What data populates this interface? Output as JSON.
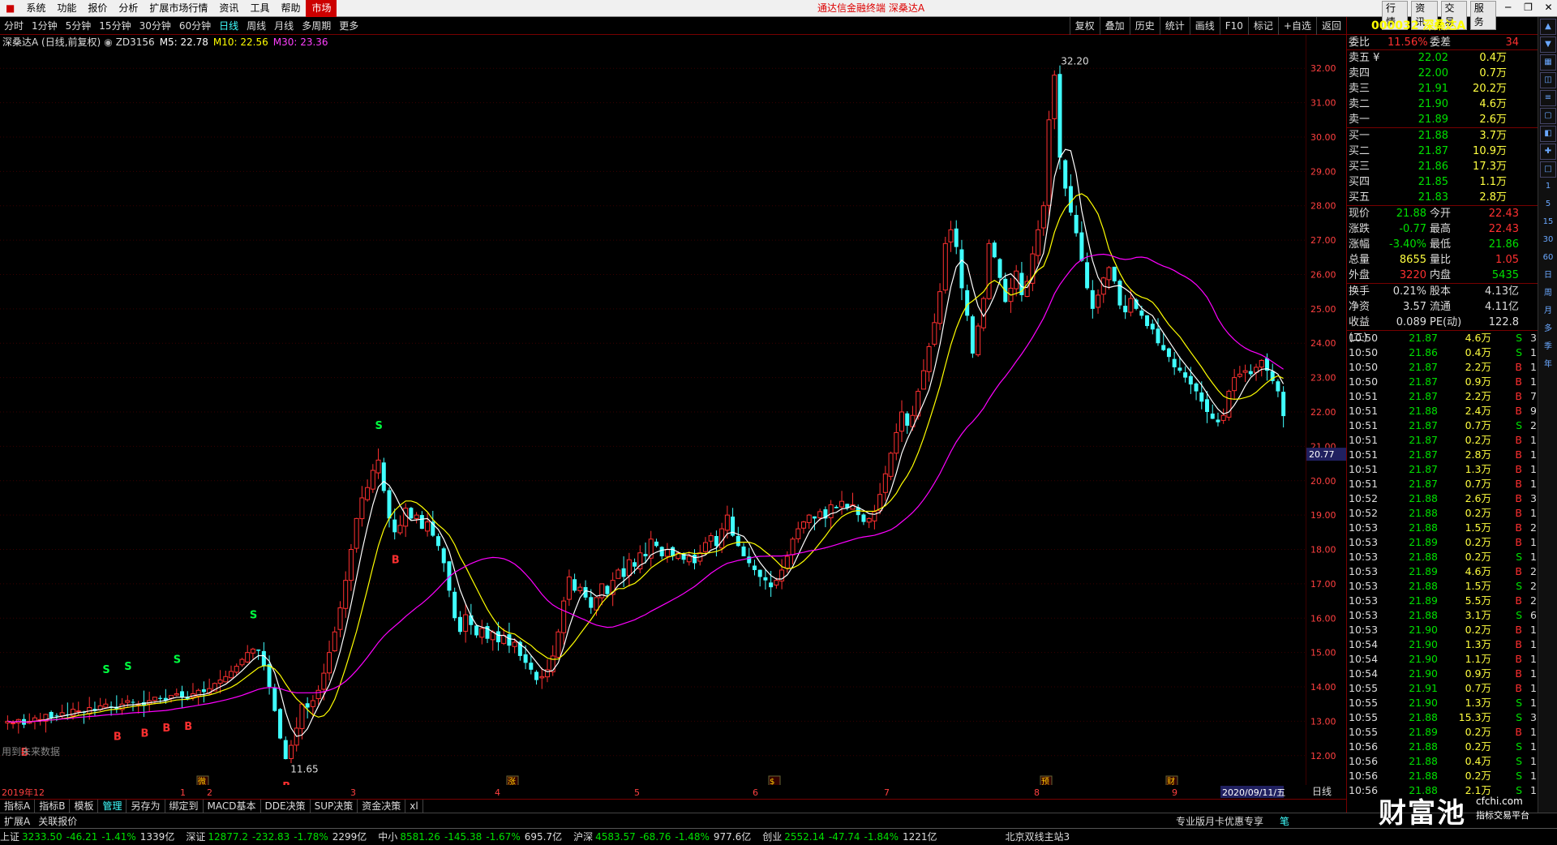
{
  "menu": {
    "items": [
      "系统",
      "功能",
      "报价",
      "分析",
      "扩展市场行情",
      "资讯",
      "工具",
      "帮助",
      "市场"
    ],
    "title": "通达信金融终端  深桑达A",
    "right_tabs": [
      "行情",
      "资讯",
      "交易",
      "服务"
    ]
  },
  "periods": [
    "分时",
    "1分钟",
    "5分钟",
    "15分钟",
    "30分钟",
    "60分钟",
    "日线",
    "周线",
    "月线",
    "多周期",
    "更多"
  ],
  "selected_period": "日线",
  "tools": [
    "复权",
    "叠加",
    "历史",
    "统计",
    "画线",
    "F10",
    "标记",
    "+自选",
    "返回"
  ],
  "info": {
    "name": "深桑达A (日线,前复权)",
    "zd": "ZD3156",
    "m5": "M5: 22.78",
    "m10": "M10: 22.56",
    "m30": "M30: 23.36"
  },
  "colors": {
    "up": "#ff3030",
    "down": "#40ffff",
    "ma5": "#ffffff",
    "ma10": "#ffff00",
    "ma30": "#ff00ff"
  },
  "chart_data": {
    "type": "candlestick",
    "ylim": [
      11.5,
      32.5
    ],
    "y_ticks": [
      "12.00",
      "13.00",
      "14.00",
      "15.00",
      "16.00",
      "17.00",
      "18.00",
      "19.00",
      "20.00",
      "21.00",
      "22.00",
      "23.00",
      "24.00",
      "25.00",
      "26.00",
      "27.00",
      "28.00",
      "29.00",
      "30.00",
      "31.00",
      "32.00"
    ],
    "cursor_price": "20.77",
    "high_label": "32.20",
    "low_label": "11.65",
    "x_labels": [
      "2019年12",
      "1",
      "2",
      "3",
      "4",
      "5",
      "6",
      "7",
      "8",
      "9"
    ],
    "date_label": "2020/09/11/五",
    "period_label": "日线",
    "future_note": "用到未来数据",
    "events": [
      "微",
      "涨",
      "$",
      "预",
      "财"
    ],
    "signals": [
      "S",
      "B",
      "S",
      "B",
      "B",
      "S",
      "B",
      "S",
      "B",
      "S",
      "S",
      "B"
    ],
    "closes": [
      13.0,
      12.95,
      13.05,
      12.9,
      13.0,
      13.1,
      13.05,
      13.2,
      13.1,
      13.15,
      13.25,
      13.2,
      13.35,
      13.3,
      13.25,
      13.4,
      13.3,
      13.45,
      13.5,
      13.4,
      13.35,
      13.5,
      13.6,
      13.55,
      13.5,
      13.45,
      13.6,
      13.7,
      13.65,
      13.6,
      13.75,
      13.8,
      13.7,
      13.65,
      13.8,
      13.9,
      13.85,
      13.95,
      14.1,
      14.2,
      14.3,
      14.45,
      14.6,
      14.8,
      15.0,
      15.1,
      15.05,
      14.6,
      14.0,
      13.3,
      12.5,
      11.9,
      12.3,
      12.8,
      13.5,
      13.4,
      13.6,
      13.9,
      14.4,
      15.0,
      15.6,
      16.3,
      17.1,
      18.0,
      18.9,
      19.5,
      19.8,
      20.3,
      20.6,
      19.7,
      18.9,
      18.5,
      18.7,
      19.2,
      18.9,
      19.0,
      18.6,
      18.8,
      18.4,
      18.1,
      17.6,
      16.8,
      16.0,
      15.6,
      16.1,
      15.8,
      15.5,
      15.7,
      15.4,
      15.6,
      15.3,
      15.5,
      15.2,
      15.3,
      14.9,
      14.7,
      14.5,
      14.2,
      14.3,
      14.5,
      14.9,
      15.6,
      16.5,
      17.2,
      16.8,
      16.9,
      16.6,
      16.3,
      16.6,
      17.0,
      16.7,
      17.1,
      17.4,
      17.2,
      17.7,
      17.5,
      17.9,
      17.8,
      18.3,
      18.1,
      17.8,
      18.0,
      17.8,
      17.9,
      17.7,
      17.8,
      17.6,
      17.9,
      18.2,
      18.4,
      18.1,
      18.6,
      19.0,
      18.4,
      18.1,
      17.8,
      17.6,
      17.4,
      17.2,
      17.1,
      16.9,
      17.1,
      17.4,
      17.8,
      18.3,
      18.6,
      18.8,
      19.0,
      18.9,
      19.1,
      18.9,
      19.3,
      19.2,
      19.4,
      19.2,
      19.3,
      19.0,
      18.8,
      18.9,
      19.1,
      19.6,
      20.2,
      20.8,
      21.4,
      22.0,
      21.6,
      21.9,
      22.6,
      23.2,
      23.9,
      24.6,
      25.5,
      26.9,
      27.3,
      26.8,
      25.6,
      24.8,
      23.7,
      24.5,
      25.3,
      26.9,
      26.5,
      25.9,
      25.2,
      25.6,
      26.1,
      25.4,
      25.8,
      26.6,
      27.3,
      28.0,
      30.5,
      31.8,
      29.4,
      28.5,
      27.8,
      27.2,
      26.4,
      25.6,
      25.0,
      25.4,
      25.9,
      26.2,
      25.8,
      25.1,
      24.9,
      25.3,
      25.0,
      24.8,
      24.5,
      24.4,
      24.0,
      23.8,
      23.6,
      23.3,
      23.2,
      23.0,
      22.8,
      22.6,
      22.3,
      22.0,
      21.8,
      21.7,
      21.9,
      22.6,
      23.0,
      23.1,
      23.2,
      23.1,
      23.3,
      23.5,
      23.2,
      22.9,
      22.6,
      21.88
    ]
  },
  "quote": {
    "code": "000032 深桑达A",
    "weibi_label": "委比",
    "weibi": "11.56%",
    "weicha_label": "委差",
    "weicha": "34",
    "sell": [
      {
        "label": "卖五 ¥",
        "price": "22.02",
        "vol": "0.4万"
      },
      {
        "label": "卖四",
        "price": "22.00",
        "vol": "0.7万"
      },
      {
        "label": "卖三",
        "price": "21.91",
        "vol": "20.2万"
      },
      {
        "label": "卖二",
        "price": "21.90",
        "vol": "4.6万"
      },
      {
        "label": "卖一",
        "price": "21.89",
        "vol": "2.6万"
      }
    ],
    "buy": [
      {
        "label": "买一",
        "price": "21.88",
        "vol": "3.7万"
      },
      {
        "label": "买二",
        "price": "21.87",
        "vol": "10.9万"
      },
      {
        "label": "买三",
        "price": "21.86",
        "vol": "17.3万"
      },
      {
        "label": "买四",
        "price": "21.85",
        "vol": "1.1万"
      },
      {
        "label": "买五",
        "price": "21.83",
        "vol": "2.8万"
      }
    ],
    "stats": [
      {
        "l1": "现价",
        "v1": "21.88",
        "c1": "dn",
        "l2": "今开",
        "v2": "22.43",
        "c2": "up"
      },
      {
        "l1": "涨跌",
        "v1": "-0.77",
        "c1": "dn",
        "l2": "最高",
        "v2": "22.43",
        "c2": "up"
      },
      {
        "l1": "涨幅",
        "v1": "-3.40%",
        "c1": "dn",
        "l2": "最低",
        "v2": "21.86",
        "c2": "dn"
      },
      {
        "l1": "总量",
        "v1": "8655",
        "c1": "yl",
        "l2": "量比",
        "v2": "1.05",
        "c2": "up"
      },
      {
        "l1": "外盘",
        "v1": "3220",
        "c1": "up",
        "l2": "内盘",
        "v2": "5435",
        "c2": "dn"
      }
    ],
    "stats2": [
      {
        "l1": "换手",
        "v1": "0.21%",
        "l2": "股本",
        "v2": "4.13亿"
      },
      {
        "l1": "净资",
        "v1": "3.57",
        "l2": "流通",
        "v2": "4.11亿"
      },
      {
        "l1": "收益(二)",
        "v1": "0.089",
        "l2": "PE(动)",
        "v2": "122.8"
      }
    ],
    "ticks": [
      {
        "t": "10:50",
        "p": "21.87",
        "v": "4.6万",
        "bs": "S",
        "n": "3"
      },
      {
        "t": "10:50",
        "p": "21.86",
        "v": "0.4万",
        "bs": "S",
        "n": "1"
      },
      {
        "t": "10:50",
        "p": "21.87",
        "v": "2.2万",
        "bs": "B",
        "n": "1"
      },
      {
        "t": "10:50",
        "p": "21.87",
        "v": "0.9万",
        "bs": "B",
        "n": "1"
      },
      {
        "t": "10:51",
        "p": "21.87",
        "v": "2.2万",
        "bs": "B",
        "n": "7"
      },
      {
        "t": "10:51",
        "p": "21.88",
        "v": "2.4万",
        "bs": "B",
        "n": "9"
      },
      {
        "t": "10:51",
        "p": "21.87",
        "v": "0.7万",
        "bs": "S",
        "n": "2"
      },
      {
        "t": "10:51",
        "p": "21.87",
        "v": "0.2万",
        "bs": "B",
        "n": "1"
      },
      {
        "t": "10:51",
        "p": "21.87",
        "v": "2.8万",
        "bs": "B",
        "n": "1"
      },
      {
        "t": "10:51",
        "p": "21.87",
        "v": "1.3万",
        "bs": "B",
        "n": "1"
      },
      {
        "t": "10:51",
        "p": "21.87",
        "v": "0.7万",
        "bs": "B",
        "n": "1"
      },
      {
        "t": "10:52",
        "p": "21.88",
        "v": "2.6万",
        "bs": "B",
        "n": "3"
      },
      {
        "t": "10:52",
        "p": "21.88",
        "v": "0.2万",
        "bs": "B",
        "n": "1"
      },
      {
        "t": "10:53",
        "p": "21.88",
        "v": "1.5万",
        "bs": "B",
        "n": "2"
      },
      {
        "t": "10:53",
        "p": "21.89",
        "v": "0.2万",
        "bs": "B",
        "n": "1"
      },
      {
        "t": "10:53",
        "p": "21.88",
        "v": "0.2万",
        "bs": "S",
        "n": "1"
      },
      {
        "t": "10:53",
        "p": "21.89",
        "v": "4.6万",
        "bs": "B",
        "n": "2"
      },
      {
        "t": "10:53",
        "p": "21.88",
        "v": "1.5万",
        "bs": "S",
        "n": "2"
      },
      {
        "t": "10:53",
        "p": "21.89",
        "v": "5.5万",
        "bs": "B",
        "n": "2"
      },
      {
        "t": "10:53",
        "p": "21.88",
        "v": "3.1万",
        "bs": "S",
        "n": "6"
      },
      {
        "t": "10:53",
        "p": "21.90",
        "v": "0.2万",
        "bs": "B",
        "n": "1"
      },
      {
        "t": "10:54",
        "p": "21.90",
        "v": "1.3万",
        "bs": "B",
        "n": "1"
      },
      {
        "t": "10:54",
        "p": "21.90",
        "v": "1.1万",
        "bs": "B",
        "n": "1"
      },
      {
        "t": "10:54",
        "p": "21.90",
        "v": "0.9万",
        "bs": "B",
        "n": "1"
      },
      {
        "t": "10:55",
        "p": "21.91",
        "v": "0.7万",
        "bs": "B",
        "n": "1"
      },
      {
        "t": "10:55",
        "p": "21.90",
        "v": "1.3万",
        "bs": "S",
        "n": "1"
      },
      {
        "t": "10:55",
        "p": "21.88",
        "v": "15.3万",
        "bs": "S",
        "n": "3"
      },
      {
        "t": "10:55",
        "p": "21.89",
        "v": "0.2万",
        "bs": "B",
        "n": "1"
      },
      {
        "t": "10:56",
        "p": "21.88",
        "v": "0.2万",
        "bs": "S",
        "n": "1"
      },
      {
        "t": "10:56",
        "p": "21.88",
        "v": "0.4万",
        "bs": "S",
        "n": "1"
      },
      {
        "t": "10:56",
        "p": "21.88",
        "v": "0.2万",
        "bs": "S",
        "n": "1"
      },
      {
        "t": "10:56",
        "p": "21.88",
        "v": "2.1万",
        "bs": "S",
        "n": "1"
      }
    ]
  },
  "side_icons": [
    "up-arrow-icon",
    "down-arrow-icon",
    "grid-icon",
    "chart-icon",
    "list-icon",
    "box-icon",
    "layers-icon",
    "cross-icon",
    "square-icon"
  ],
  "side_labels": [
    "1",
    "5",
    "15",
    "30",
    "60",
    "日",
    "周",
    "月",
    "多",
    "季",
    "年"
  ],
  "tabs": [
    "指标A",
    "指标B",
    "模板",
    "管理",
    "另存为",
    "绑定到",
    "MACD基本",
    "DDE决策",
    "SUP决策",
    "资金决策",
    "xl"
  ],
  "bottom2": {
    "left": [
      "扩展A",
      "关联报价"
    ],
    "promo": "专业版月卡优惠专享",
    "mode": "笔"
  },
  "status": [
    {
      "name": "上证",
      "val": "3233.50",
      "chg": "-46.21",
      "pct": "-1.41%",
      "amt": "1339亿"
    },
    {
      "name": "深证",
      "val": "12877.2",
      "chg": "-232.83",
      "pct": "-1.78%",
      "amt": "2299亿"
    },
    {
      "name": "中小",
      "val": "8581.26",
      "chg": "-145.38",
      "pct": "-1.67%",
      "amt": "695.7亿"
    },
    {
      "name": "沪深",
      "val": "4583.57",
      "chg": "-68.76",
      "pct": "-1.48%",
      "amt": "977.6亿"
    },
    {
      "name": "创业",
      "val": "2552.14",
      "chg": "-47.74",
      "pct": "-1.84%",
      "amt": "1221亿"
    }
  ],
  "server": "北京双线主站3",
  "watermark": {
    "brand": "财富池",
    "url": "cfchi.com",
    "sub": "指标交易平台"
  }
}
